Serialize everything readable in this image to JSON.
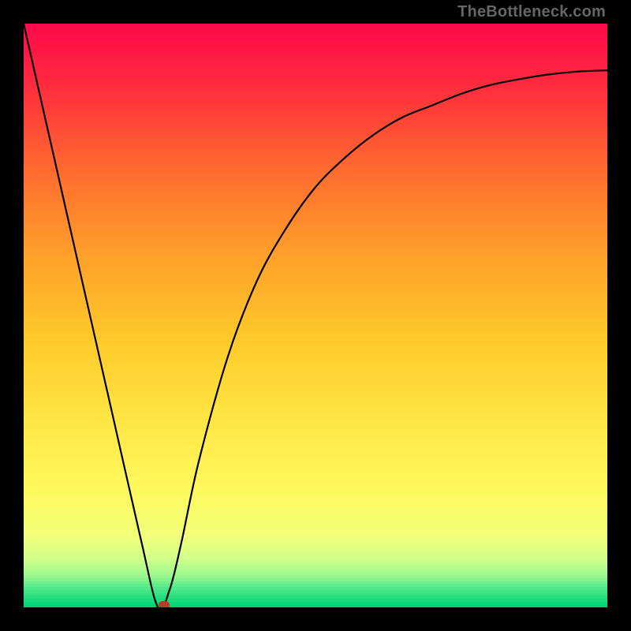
{
  "watermark": "TheBottleneck.com",
  "chart_data": {
    "type": "line",
    "title": "",
    "xlabel": "",
    "ylabel": "",
    "xlim": [
      0,
      100
    ],
    "ylim": [
      0,
      100
    ],
    "grid": false,
    "legend": false,
    "series": [
      {
        "name": "bottleneck-curve",
        "x": [
          0,
          5,
          10,
          15,
          20,
          23,
          25,
          27,
          30,
          35,
          40,
          45,
          50,
          55,
          60,
          65,
          70,
          75,
          80,
          85,
          90,
          95,
          100
        ],
        "y": [
          100,
          78,
          56,
          34,
          12,
          0,
          3,
          11,
          25,
          43,
          56,
          65,
          72,
          77,
          81,
          84,
          86,
          88,
          89.5,
          90.5,
          91.3,
          91.8,
          92
        ]
      }
    ],
    "marker": {
      "x": 24,
      "y": 0,
      "color": "#b93a2e"
    },
    "background_gradient": {
      "stops": [
        {
          "pct": 0,
          "color": "#ff0a4a"
        },
        {
          "pct": 10,
          "color": "#ff2a3e"
        },
        {
          "pct": 25,
          "color": "#ff6b2f"
        },
        {
          "pct": 40,
          "color": "#ffa12a"
        },
        {
          "pct": 55,
          "color": "#ffcc2a"
        },
        {
          "pct": 70,
          "color": "#ffe948"
        },
        {
          "pct": 80,
          "color": "#fff95e"
        },
        {
          "pct": 88,
          "color": "#f1ff7a"
        },
        {
          "pct": 92,
          "color": "#d0ff8a"
        },
        {
          "pct": 95,
          "color": "#95f78e"
        },
        {
          "pct": 97,
          "color": "#4de88a"
        },
        {
          "pct": 100,
          "color": "#00d474"
        }
      ]
    }
  }
}
